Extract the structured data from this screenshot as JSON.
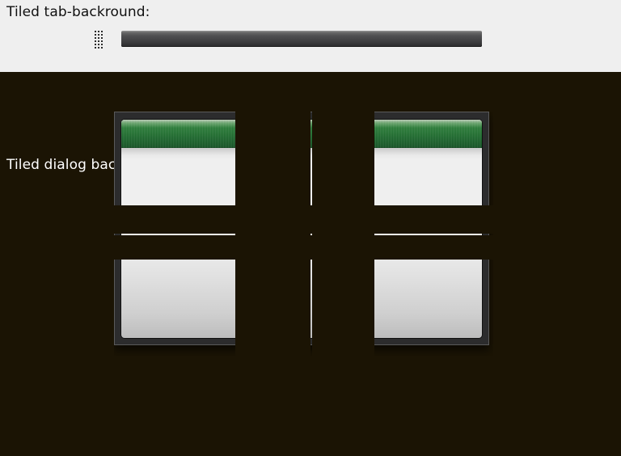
{
  "tab_section": {
    "heading": "Tiled tab-backround:",
    "background_color": "#efefef",
    "tab_bar_color": "#3c3c3e"
  },
  "dialog_section": {
    "heading": "Tiled dialog background:",
    "background_color": "#1b1404",
    "titlebar_color": "#1e6a2e",
    "body_color": "#efefef"
  },
  "icons": {
    "grip": "grip-handle-icon"
  }
}
